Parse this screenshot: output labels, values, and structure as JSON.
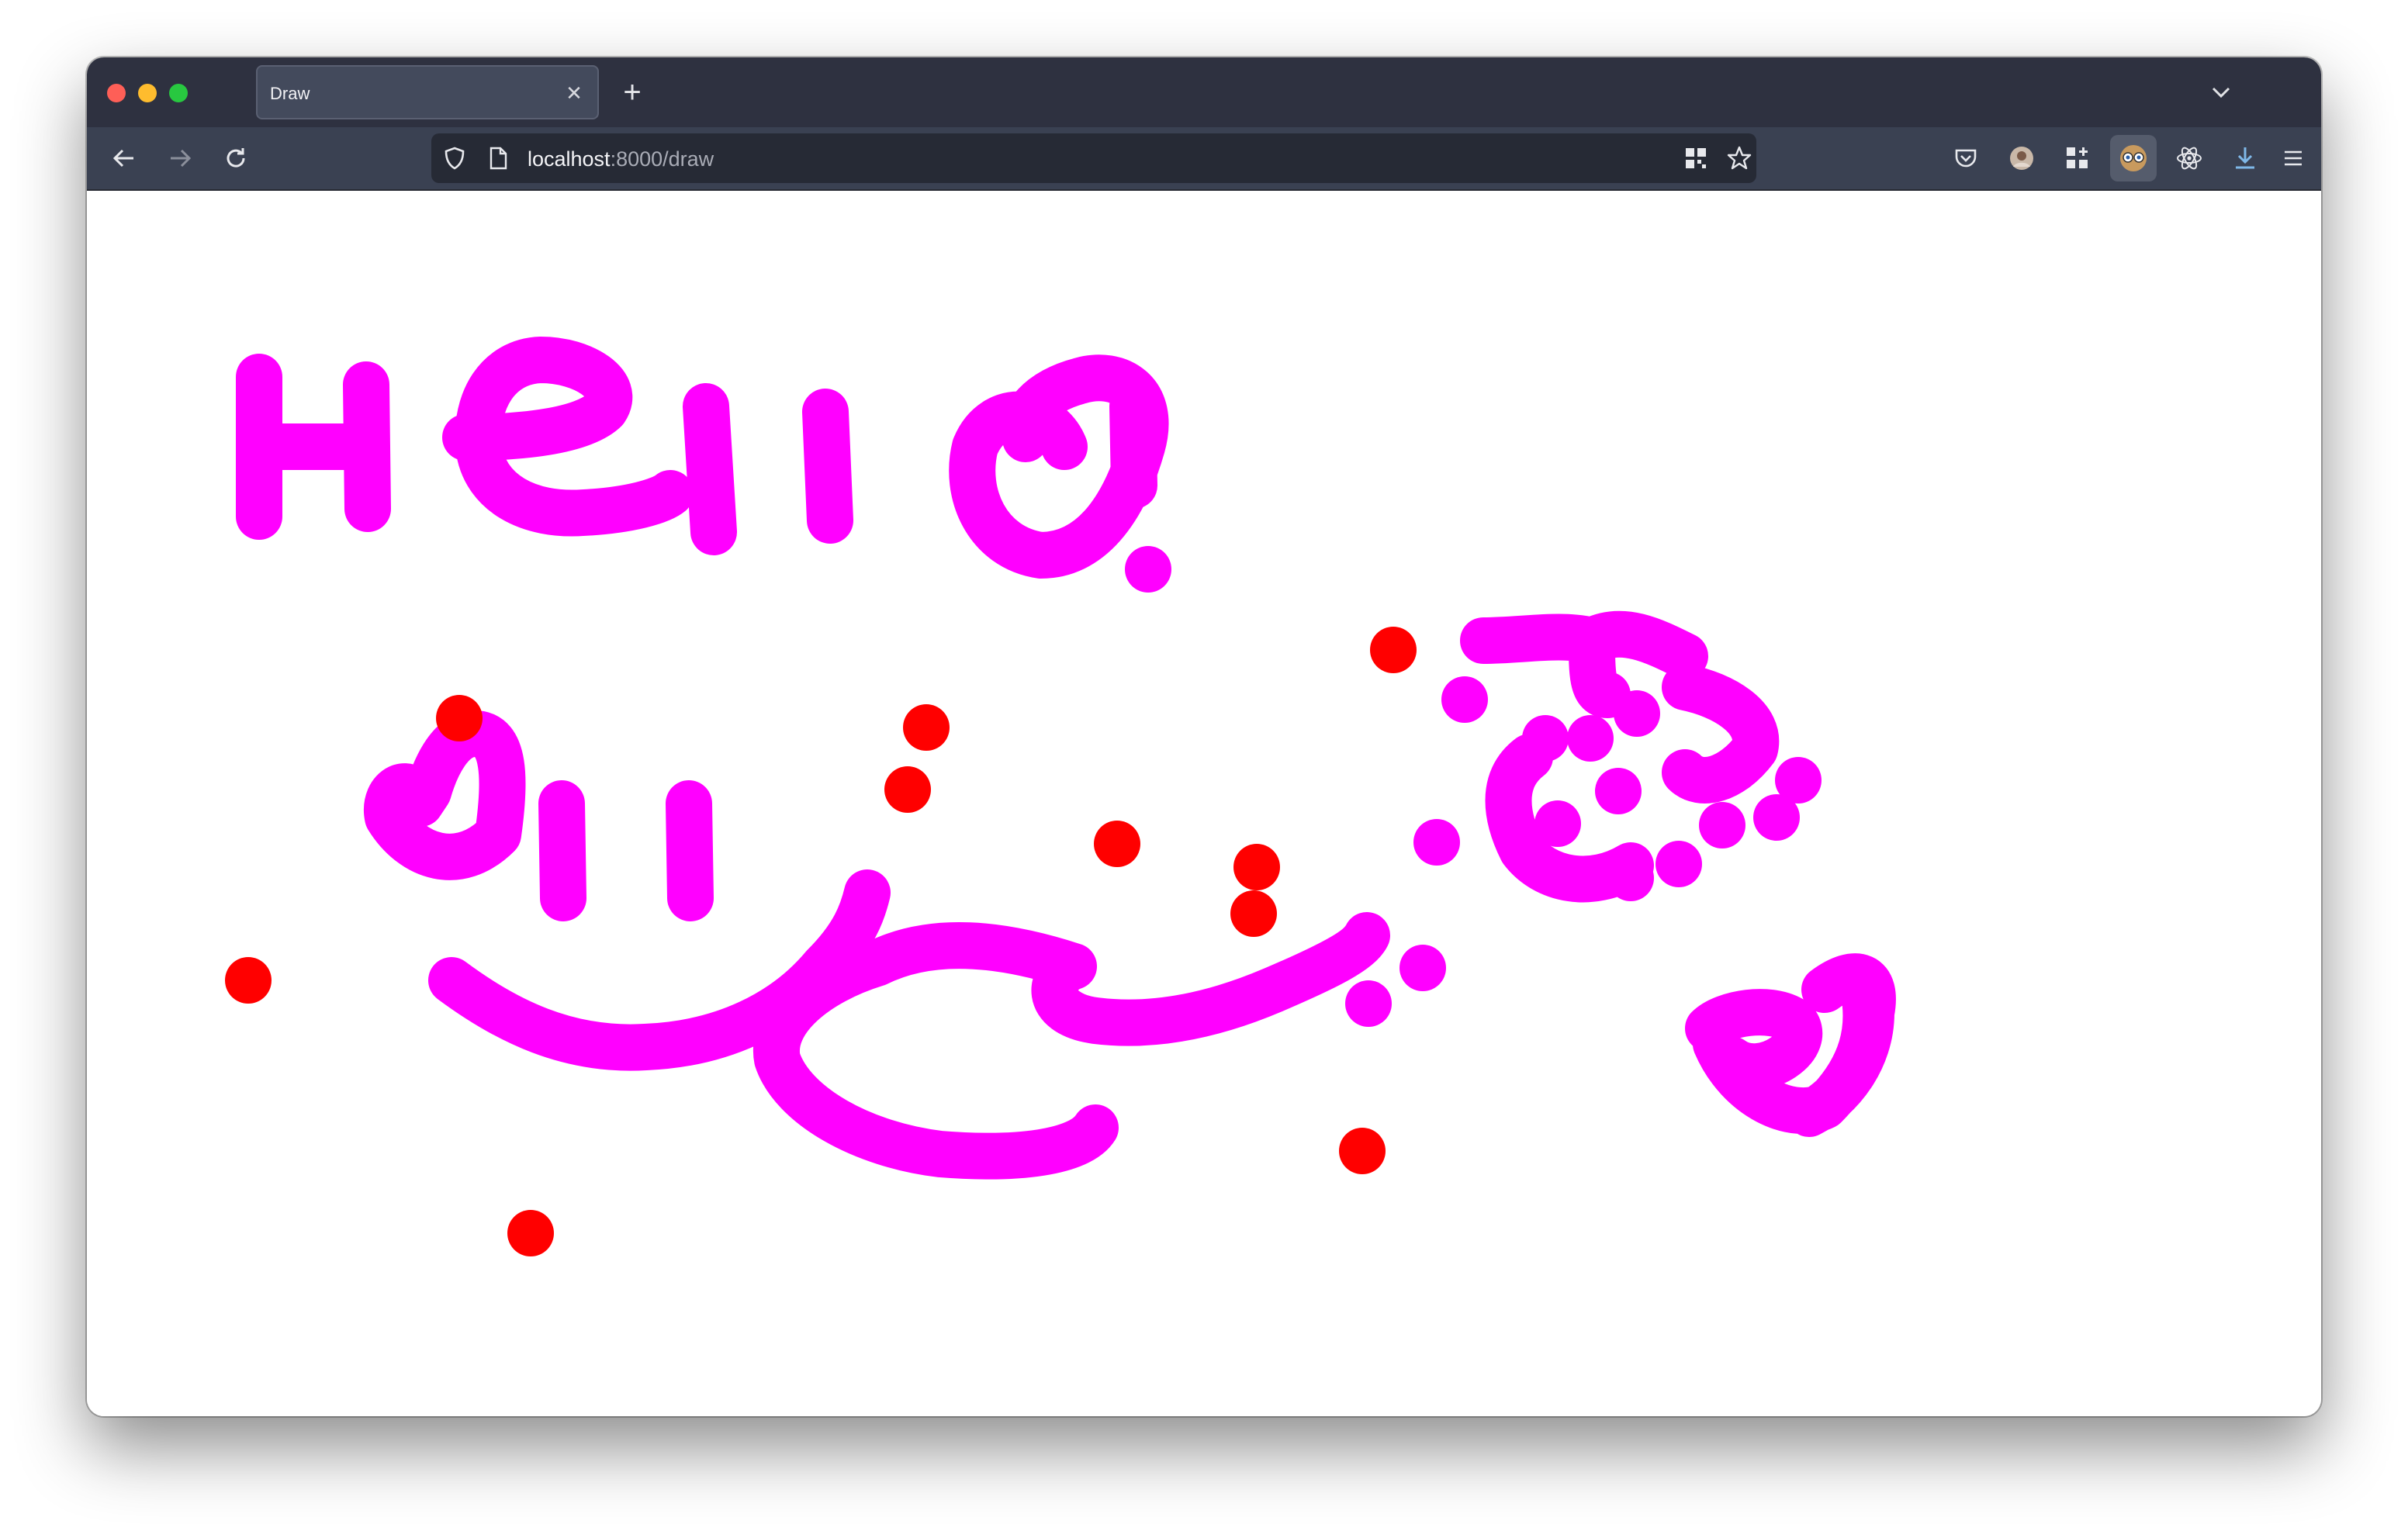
{
  "browser": {
    "tab": {
      "title": "Draw"
    },
    "url": {
      "host": "localhost",
      "path": ":8000/draw"
    }
  },
  "icons": {
    "back": "back-arrow-icon",
    "forward": "forward-arrow-icon",
    "reload": "reload-icon",
    "shield": "shield-icon",
    "page": "page-icon",
    "qr": "qr-code-icon",
    "bookmark": "star-icon",
    "pocket": "pocket-icon",
    "extensions": [
      "avatar-extension-icon",
      "extensions-grid-icon",
      "eyes-extension-icon",
      "react-icon"
    ],
    "downloads": "download-icon",
    "menu": "hamburger-menu-icon"
  },
  "drawing": {
    "colors": {
      "magenta": "#ff00ff",
      "red": "#ff0000"
    },
    "content": "freehand strokes spelling Hello! with a smiley face, hearts and red dots"
  }
}
